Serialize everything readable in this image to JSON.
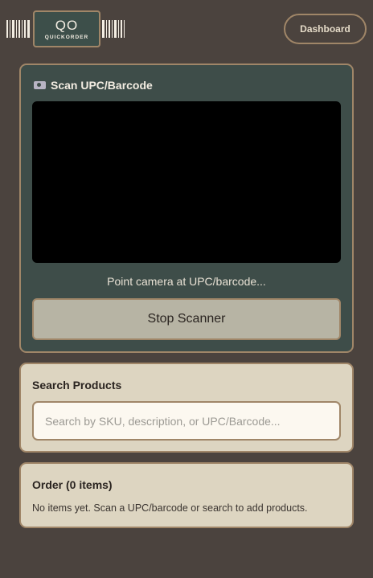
{
  "header": {
    "logo_title": "QO",
    "logo_subtitle": "QUICKORDER",
    "dashboard_label": "Dashboard"
  },
  "scanner": {
    "title": "Scan UPC/Barcode",
    "title_icon": "camera-icon",
    "hint": "Point camera at UPC/barcode...",
    "stop_label": "Stop Scanner"
  },
  "search": {
    "title": "Search Products",
    "placeholder": "Search by SKU, description, or UPC/Barcode...",
    "value": ""
  },
  "order": {
    "title": "Order (0 items)",
    "empty_text": "No items yet. Scan a UPC/barcode or search to add products."
  },
  "colors": {
    "background": "#4b433e",
    "scanner_card": "#3e4d49",
    "light_card": "#ddd5c1",
    "border": "#a08668",
    "stop_button": "#b7b4a4",
    "video": "#000000"
  }
}
